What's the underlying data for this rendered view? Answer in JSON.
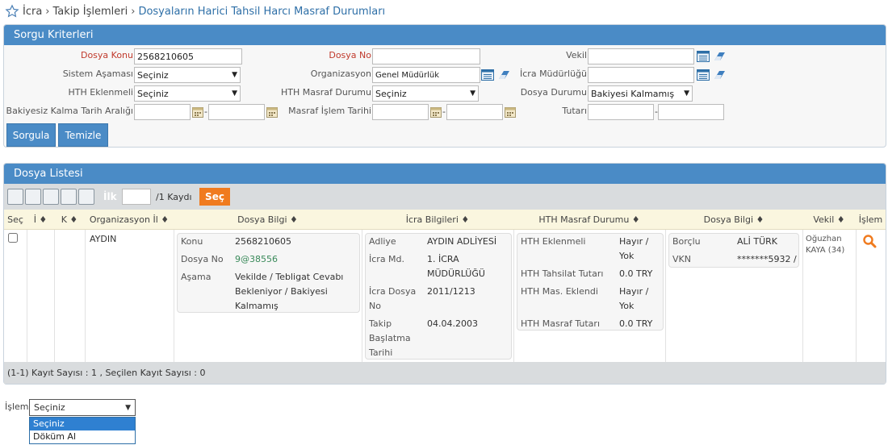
{
  "breadcrumb": [
    "İcra",
    "Takip İşlemleri",
    "Dosyaların Harici Tahsil Harcı Masraf Durumları"
  ],
  "criteria": {
    "title": "Sorgu Kriterleri",
    "dosya_konu": {
      "label": "Dosya Konu",
      "value": "2568210605"
    },
    "dosya_no": {
      "label": "Dosya No",
      "value": ""
    },
    "vekil": {
      "label": "Vekil",
      "value": ""
    },
    "sistem_asamasi": {
      "label": "Sistem Aşaması",
      "value": "Seçiniz"
    },
    "organizasyon": {
      "label": "Organizasyon",
      "value": "Genel Müdürlük"
    },
    "icra_mudurlugu": {
      "label": "İcra Müdürlüğü",
      "value": ""
    },
    "hth_eklenmeli": {
      "label": "HTH Eklenmeli",
      "value": "Seçiniz"
    },
    "hth_masraf_durumu": {
      "label": "HTH Masraf Durumu",
      "value": "Seçiniz"
    },
    "dosya_durumu": {
      "label": "Dosya Durumu",
      "value": "Bakiyesi Kalmamış"
    },
    "bakiyesiz_tarih": {
      "label": "Bakiyesiz Kalma Tarih Aralığı",
      "from": "",
      "to": ""
    },
    "masraf_tarih": {
      "label": "Masraf İşlem Tarihi",
      "from": "",
      "to": ""
    },
    "tutari": {
      "label": "Tutarı",
      "from": "",
      "to": ""
    },
    "dash": "-",
    "buttons": {
      "sorgula": "Sorgula",
      "temizle": "Temizle"
    }
  },
  "list": {
    "title": "Dosya Listesi",
    "pager": {
      "ilk": "İlk",
      "page_value": "",
      "total": "/1 Kaydı",
      "sec_btn": "Seç"
    },
    "columns": {
      "sec": "Seç",
      "i": "İ ♦",
      "k": "K ♦",
      "org": "Organizasyon İl ♦",
      "dosya_bilgi": "Dosya Bilgi ♦",
      "icra_bilgileri": "İcra Bilgileri ♦",
      "hth_masraf": "HTH Masraf Durumu ♦",
      "dosya_bilgi2": "Dosya Bilgi ♦",
      "vekil": "Vekil ♦",
      "islem": "İşlem"
    },
    "row": {
      "org": "AYDIN",
      "dosya": {
        "konu_k": "Konu",
        "konu_v": "2568210605",
        "no_k": "Dosya No",
        "no_v": "9@38556",
        "asama_k": "Aşama",
        "asama_v": "Vekilde / Tebligat Cevabı Bekleniyor / Bakiyesi Kalmamış"
      },
      "icra": {
        "adliye_k": "Adliye",
        "adliye_v": "AYDIN ADLİYESİ",
        "md_k": "İcra Md.",
        "md_v": "1. İCRA MÜDÜRLÜĞÜ",
        "dosya_k": "İcra Dosya No",
        "dosya_v": "2011/1213",
        "tarih_k": "Takip Başlatma Tarihi",
        "tarih_v": "04.04.2003"
      },
      "hth": {
        "ekl_k": "HTH Eklenmeli",
        "ekl_v": "Hayır / Yok",
        "tahsilat_k": "HTH Tahsilat Tutarı",
        "tahsilat_v": "0.0 TRY",
        "mas_k": "HTH Mas. Eklendi",
        "mas_v": "Hayır / Yok",
        "tutar_k": "HTH Masraf Tutarı",
        "tutar_v": "0.0 TRY"
      },
      "borclu": {
        "borclu_k": "Borçlu",
        "borclu_v": "ALİ TÜRK",
        "vkn_k": "VKN",
        "vkn_v": "*******5932 /"
      },
      "vekil": "Oğuzhan KAYA (34)"
    },
    "footer": "(1-1) Kayıt Sayısı : 1 , Seçilen Kayıt Sayısı : 0"
  },
  "islem": {
    "label": "İşlem",
    "selected": "Seçiniz",
    "options": [
      "Seçiniz",
      "Döküm Al"
    ]
  },
  "colors": {
    "header_blue": "#4a8bc6",
    "accent_orange": "#f07b1f",
    "grid_head": "#faf6df"
  }
}
